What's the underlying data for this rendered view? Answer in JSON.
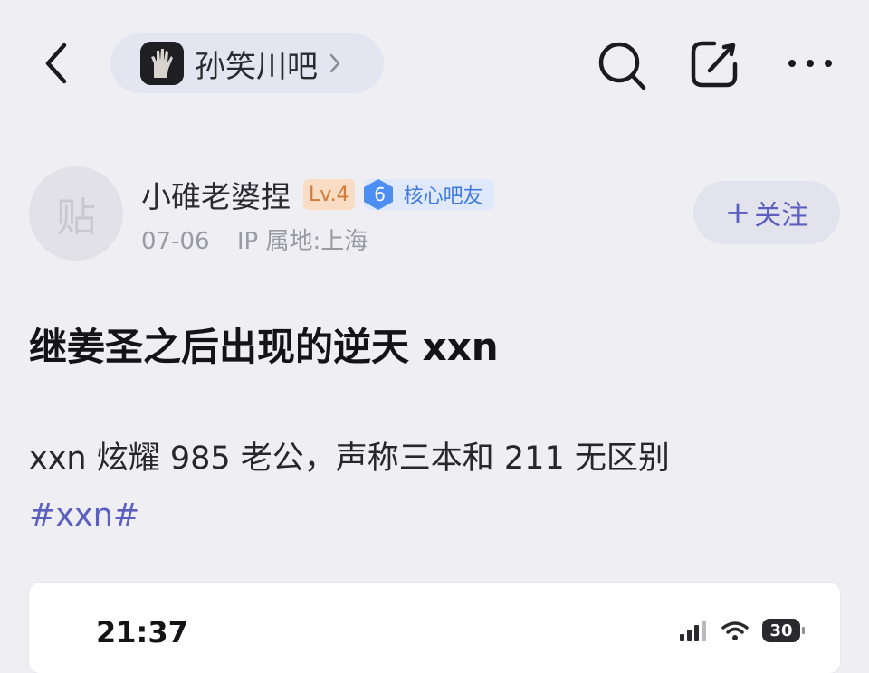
{
  "header": {
    "forum_name": "孙笑川吧",
    "back_icon": "back-arrow-icon",
    "search_icon": "search-icon",
    "share_icon": "share-icon",
    "more_icon": "more-icon"
  },
  "author": {
    "avatar_text": "贴",
    "name": "小碓老婆捏",
    "level": "Lv.4",
    "core_badge_number": "6",
    "core_badge_label": "核心吧友",
    "date": "07-06",
    "ip_location": "IP 属地:上海",
    "follow_label": "关注"
  },
  "post": {
    "title": "继姜圣之后出现的逆天 xxn",
    "body": "xxn 炫耀 985 老公，声称三本和 211 无区别",
    "tag": "#xxn#"
  },
  "embedded_screenshot": {
    "time": "21:37",
    "battery": "30"
  },
  "colors": {
    "background": "#efeef3",
    "accent": "#5b5fc0",
    "level_badge": "#d27a37",
    "core_badge": "#3f78e1"
  }
}
